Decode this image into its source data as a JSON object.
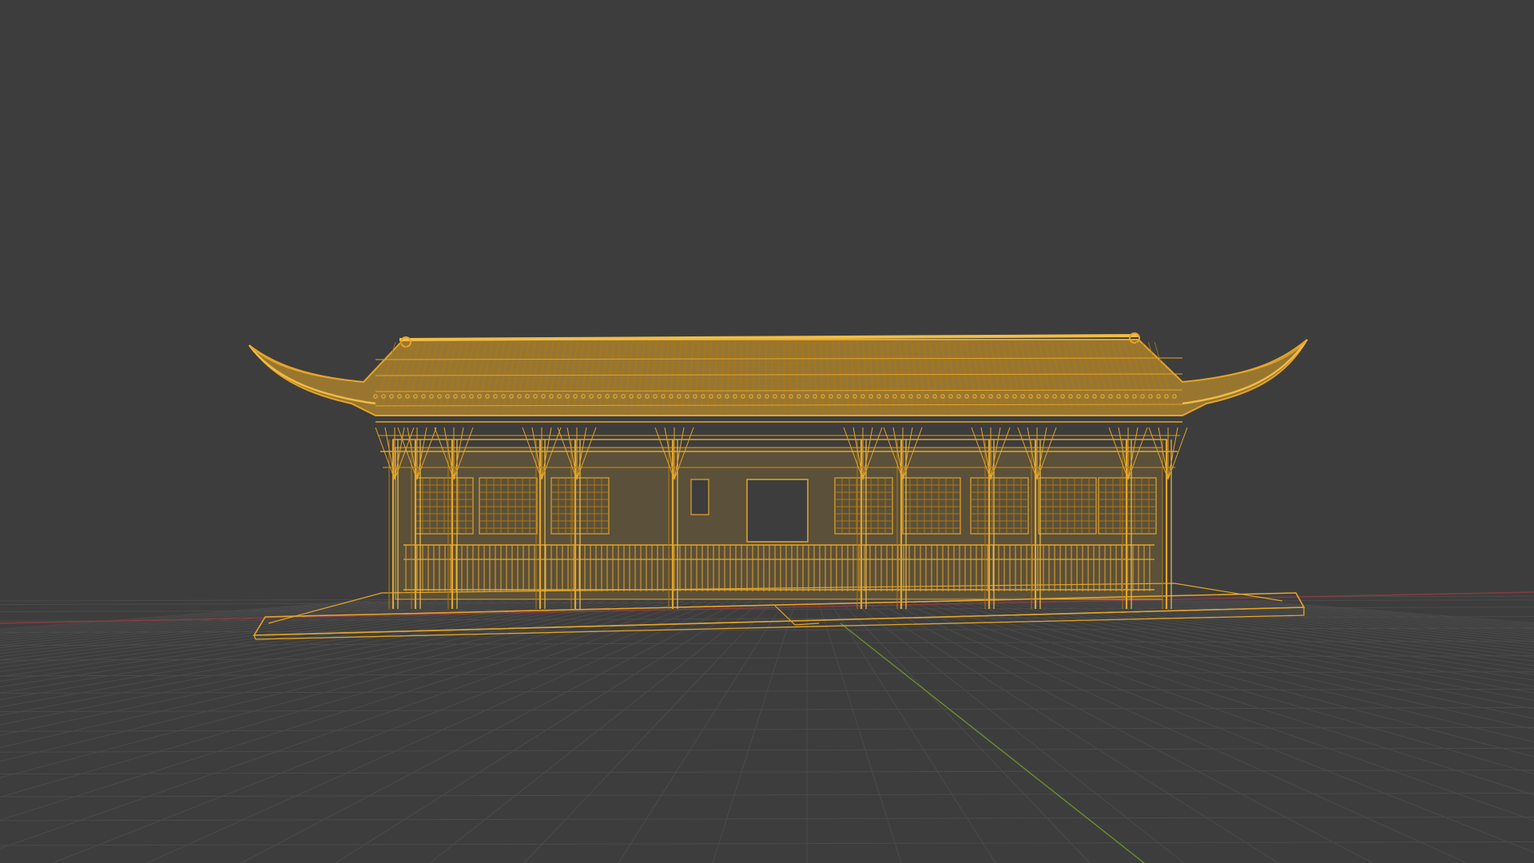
{
  "viewport": {
    "view_mode": "wireframe",
    "object_type": "chinese-pavilion-model",
    "selected": true
  },
  "colors": {
    "background": "#3d3d3d",
    "grid_line": "#4b4b4b",
    "x_axis": "#8a3b45",
    "y_axis": "#6b8f2e",
    "wire_primary": "#e5a527",
    "wire_dark": "#b07a12",
    "wire_light": "#f1bd45"
  }
}
